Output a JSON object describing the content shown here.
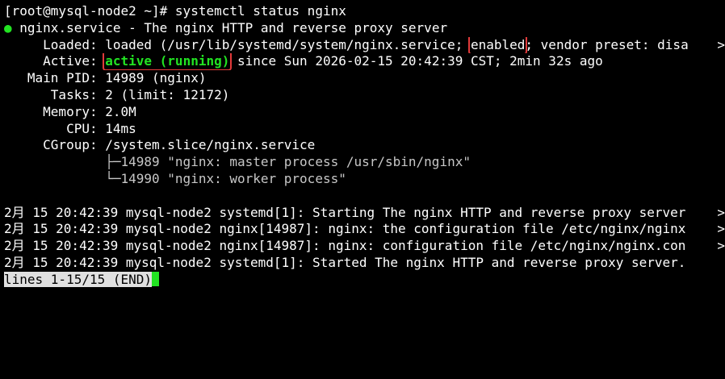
{
  "terminal": {
    "prompt": "[root@mysql-node2 ~]# ",
    "command": "systemctl status nginx",
    "status_dot": "●",
    "service_line": " nginx.service - The nginx HTTP and reverse proxy server",
    "loaded_prefix": "     Loaded: loaded (/usr/lib/systemd/system/nginx.service; ",
    "loaded_enabled": "enabled",
    "loaded_suffix": "; vendor preset: disa",
    "active_prefix": "     Active: ",
    "active_state": "active (running)",
    "active_suffix": " since Sun 2026-02-15 20:42:39 CST; 2min 32s ago",
    "main_pid": "   Main PID: 14989 (nginx)",
    "tasks": "      Tasks: 2 (limit: 12172)",
    "memory": "     Memory: 2.0M",
    "cpu": "        CPU: 14ms",
    "cgroup": "     CGroup: /system.slice/nginx.service",
    "cgroup_child_1": "             ├─14989 \"nginx: master process /usr/sbin/nginx\"",
    "cgroup_child_2": "             └─14990 \"nginx: worker process\"",
    "log_lines": [
      "2月 15 20:42:39 mysql-node2 systemd[1]: Starting The nginx HTTP and reverse proxy server",
      "2月 15 20:42:39 mysql-node2 nginx[14987]: nginx: the configuration file /etc/nginx/nginx",
      "2月 15 20:42:39 mysql-node2 nginx[14987]: nginx: configuration file /etc/nginx/nginx.con",
      "2月 15 20:42:39 mysql-node2 systemd[1]: Started The nginx HTTP and reverse proxy server."
    ],
    "truncation_marker": ">",
    "pager_status": "lines 1-15/15 (END)"
  },
  "colors": {
    "background": "#000000",
    "foreground": "#ffffff",
    "green": "#22e322",
    "highlight_box": "#e23a3a",
    "pager_bg": "#e0e0e0"
  }
}
